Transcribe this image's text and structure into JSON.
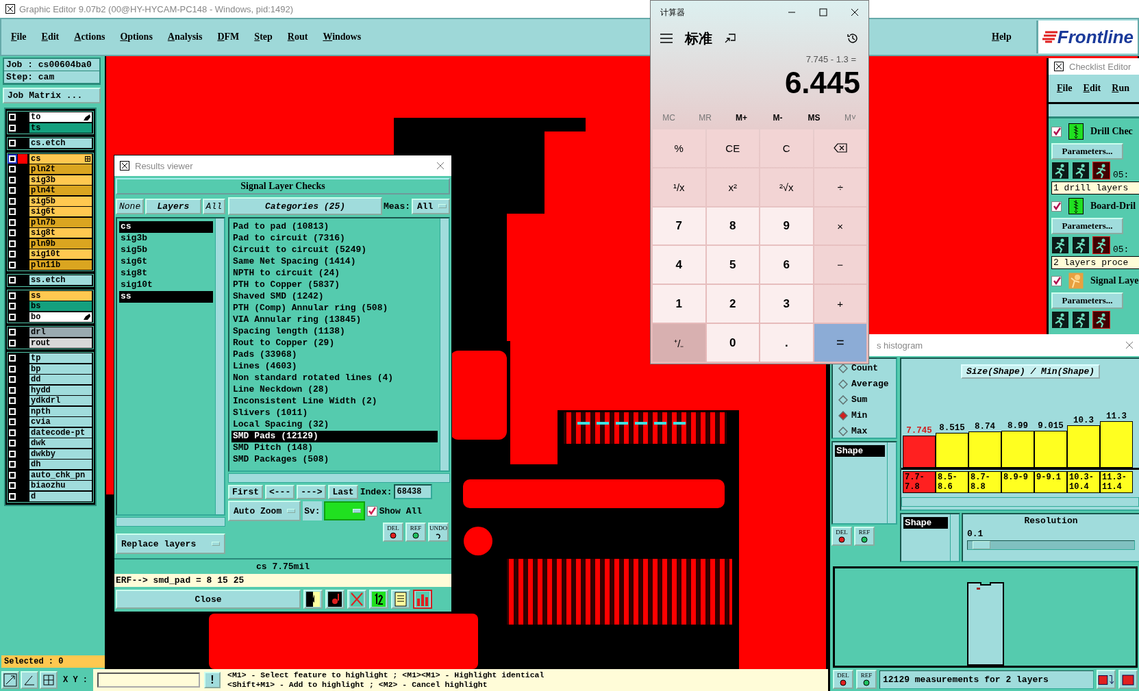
{
  "window": {
    "title": "Graphic Editor 9.07b2 (00@HY-HYCAM-PC148 - Windows, pid:1492)"
  },
  "menu": [
    "File",
    "Edit",
    "Actions",
    "Options",
    "Analysis",
    "DFM",
    "Step",
    "Rout",
    "Windows"
  ],
  "help": "Help",
  "logo": "Frontline",
  "job_panel": {
    "job": "Job : cs00604ba0",
    "step": "Step: cam",
    "matrix_button": "Job Matrix ...",
    "layer_groups": [
      {
        "layers": [
          {
            "name": "to",
            "color": "#ffffff",
            "flagged": true,
            "work_layer": false
          },
          {
            "name": "ts",
            "color": "#14a07e",
            "flagged": false,
            "work_layer": false
          }
        ]
      },
      {
        "layers": [
          {
            "name": "cs.etch",
            "color": "#a0dcdc",
            "flagged": false,
            "work_layer": false
          }
        ]
      },
      {
        "layers": [
          {
            "name": "cs",
            "color": "#ffc850",
            "flagged": false,
            "work_layer": true
          },
          {
            "name": "pln2t",
            "color": "#daa520",
            "flagged": false,
            "work_layer": false
          },
          {
            "name": "sig3b",
            "color": "#ffc850",
            "flagged": false,
            "work_layer": false
          },
          {
            "name": "pln4t",
            "color": "#daa520",
            "flagged": false,
            "work_layer": false
          },
          {
            "name": "sig5b",
            "color": "#ffc850",
            "flagged": false,
            "work_layer": false
          },
          {
            "name": "sig6t",
            "color": "#ffc850",
            "flagged": false,
            "work_layer": false
          },
          {
            "name": "pln7b",
            "color": "#daa520",
            "flagged": false,
            "work_layer": false
          },
          {
            "name": "sig8t",
            "color": "#ffc850",
            "flagged": false,
            "work_layer": false
          },
          {
            "name": "pln9b",
            "color": "#daa520",
            "flagged": false,
            "work_layer": false
          },
          {
            "name": "sig10t",
            "color": "#ffc850",
            "flagged": false,
            "work_layer": false
          },
          {
            "name": "pln11b",
            "color": "#daa520",
            "flagged": false,
            "work_layer": false
          }
        ]
      },
      {
        "layers": [
          {
            "name": "ss.etch",
            "color": "#a0dcdc",
            "flagged": false,
            "work_layer": false
          }
        ]
      },
      {
        "layers": [
          {
            "name": "ss",
            "color": "#ffc850",
            "flagged": false,
            "work_layer": false
          },
          {
            "name": "bs",
            "color": "#14a07e",
            "flagged": false,
            "work_layer": false
          },
          {
            "name": "bo",
            "color": "#ffffff",
            "flagged": true,
            "work_layer": false
          }
        ]
      },
      {
        "layers": [
          {
            "name": "drl",
            "color": "#9aaab0",
            "flagged": false,
            "work_layer": false
          },
          {
            "name": "rout",
            "color": "#d8d8d8",
            "flagged": false,
            "work_layer": false
          }
        ]
      },
      {
        "layers": [
          {
            "name": "tp",
            "color": "#a0dcdc",
            "flagged": false,
            "work_layer": false
          },
          {
            "name": "bp",
            "color": "#a0dcdc",
            "flagged": false,
            "work_layer": false
          },
          {
            "name": "dd",
            "color": "#a0dcdc",
            "flagged": false,
            "work_layer": false
          },
          {
            "name": "hydd",
            "color": "#a0dcdc",
            "flagged": false,
            "work_layer": false
          },
          {
            "name": "ydkdrl",
            "color": "#a0dcdc",
            "flagged": false,
            "work_layer": false
          },
          {
            "name": "npth",
            "color": "#a0dcdc",
            "flagged": false,
            "work_layer": false
          },
          {
            "name": "cvia",
            "color": "#a0dcdc",
            "flagged": false,
            "work_layer": false
          },
          {
            "name": "datecode-pt",
            "color": "#a0dcdc",
            "flagged": false,
            "work_layer": false
          },
          {
            "name": "dwk",
            "color": "#a0dcdc",
            "flagged": false,
            "work_layer": false
          },
          {
            "name": "dwkby",
            "color": "#a0dcdc",
            "flagged": false,
            "work_layer": false
          },
          {
            "name": "dh",
            "color": "#a0dcdc",
            "flagged": false,
            "work_layer": false
          },
          {
            "name": "auto_chk_pn",
            "color": "#a0dcdc",
            "flagged": false,
            "work_layer": false
          },
          {
            "name": "biaozhu",
            "color": "#a0dcdc",
            "flagged": false,
            "work_layer": false
          },
          {
            "name": "d",
            "color": "#a0dcdc",
            "flagged": false,
            "work_layer": false
          }
        ]
      }
    ],
    "selected_count": "Selected : 0"
  },
  "results_viewer": {
    "title": "Results viewer",
    "header": "Signal Layer Checks",
    "layer_buttons": [
      {
        "label": "None",
        "selected": false
      },
      {
        "label": "Layers",
        "selected": true
      },
      {
        "label": "All",
        "selected": false
      }
    ],
    "layers": [
      {
        "name": "cs",
        "selected": true
      },
      {
        "name": "sig3b",
        "selected": false
      },
      {
        "name": "sig5b",
        "selected": false
      },
      {
        "name": "sig6t",
        "selected": false
      },
      {
        "name": "sig8t",
        "selected": false
      },
      {
        "name": "sig10t",
        "selected": false
      },
      {
        "name": "ss",
        "selected": true
      }
    ],
    "categories_button": "Categories (25)",
    "meas_label": "Meas:",
    "meas_value": "All",
    "categories": [
      {
        "label": "Pad to pad (10813)",
        "selected": false
      },
      {
        "label": "Pad to circuit (7316)",
        "selected": false
      },
      {
        "label": "Circuit to circuit (5249)",
        "selected": false
      },
      {
        "label": "Same Net Spacing (1414)",
        "selected": false
      },
      {
        "label": "NPTH to circuit (24)",
        "selected": false
      },
      {
        "label": "PTH to Copper (5837)",
        "selected": false
      },
      {
        "label": "Shaved SMD (1242)",
        "selected": false
      },
      {
        "label": "PTH (Comp) Annular ring (508)",
        "selected": false
      },
      {
        "label": "VIA Annular ring (13845)",
        "selected": false
      },
      {
        "label": "Spacing length (1138)",
        "selected": false
      },
      {
        "label": "Rout to Copper (29)",
        "selected": false
      },
      {
        "label": "Pads (33968)",
        "selected": false
      },
      {
        "label": "Lines (4603)",
        "selected": false
      },
      {
        "label": "Non standard rotated lines (4)",
        "selected": false
      },
      {
        "label": "Line Neckdown (28)",
        "selected": false
      },
      {
        "label": "Inconsistent Line Width (2)",
        "selected": false
      },
      {
        "label": "Slivers (1011)",
        "selected": false
      },
      {
        "label": "Local Spacing (32)",
        "selected": false
      },
      {
        "label": "SMD Pads (12129)",
        "selected": true
      },
      {
        "label": "SMD Pitch (148)",
        "selected": false
      },
      {
        "label": "SMD Packages (508)",
        "selected": false
      }
    ],
    "nav": [
      "First",
      "<---",
      "--->",
      "Last"
    ],
    "index_label": "Index:",
    "index_value": "68438",
    "zoom_mode": "Auto Zoom",
    "sv_label": "Sv:",
    "show_all": {
      "label": "Show All",
      "checked": true
    },
    "replace_layers": "Replace layers",
    "small_buttons": [
      "DEL",
      "REF",
      "UNDO"
    ],
    "status": "cs 7.75mil",
    "erf_line": "ERF--> smd_pad = 8 15 25",
    "close": "Close",
    "tools": [
      {
        "kind": "pointer",
        "selected": false
      },
      {
        "kind": "marker",
        "selected": false
      },
      {
        "kind": "cross",
        "selected": false
      },
      {
        "kind": "number",
        "selected": false
      },
      {
        "kind": "report",
        "selected": false
      },
      {
        "kind": "histogram",
        "selected": true
      }
    ]
  },
  "calculator": {
    "title": "计算器",
    "mode": "标准",
    "expression": "7.745 - 1.3 =",
    "result": "6.445",
    "memory": [
      {
        "label": "MC",
        "disabled": true
      },
      {
        "label": "MR",
        "disabled": true
      },
      {
        "label": "M+",
        "disabled": false
      },
      {
        "label": "M-",
        "disabled": false
      },
      {
        "label": "MS",
        "disabled": false
      },
      {
        "label": "M˅",
        "disabled": true
      }
    ],
    "keys": [
      {
        "label": "%",
        "kind": "op",
        "hovered": false
      },
      {
        "label": "CE",
        "kind": "op",
        "hovered": false
      },
      {
        "label": "C",
        "kind": "op",
        "hovered": false
      },
      {
        "kind": "backspace",
        "hovered": false
      },
      {
        "label": "¹/x",
        "kind": "op",
        "hovered": false
      },
      {
        "label": "x²",
        "kind": "op",
        "hovered": false
      },
      {
        "label": "²√x",
        "kind": "op",
        "hovered": false
      },
      {
        "label": "÷",
        "kind": "op",
        "hovered": false
      },
      {
        "label": "7",
        "kind": "digit",
        "hovered": false
      },
      {
        "label": "8",
        "kind": "digit",
        "hovered": false
      },
      {
        "label": "9",
        "kind": "digit",
        "hovered": false
      },
      {
        "label": "×",
        "kind": "op",
        "hovered": false
      },
      {
        "label": "4",
        "kind": "digit",
        "hovered": false
      },
      {
        "label": "5",
        "kind": "digit",
        "hovered": false
      },
      {
        "label": "6",
        "kind": "digit",
        "hovered": false
      },
      {
        "label": "−",
        "kind": "op",
        "hovered": false
      },
      {
        "label": "1",
        "kind": "digit",
        "hovered": false
      },
      {
        "label": "2",
        "kind": "digit",
        "hovered": false
      },
      {
        "label": "3",
        "kind": "digit",
        "hovered": false
      },
      {
        "label": "+",
        "kind": "op",
        "hovered": false
      },
      {
        "label": "⁺/₋",
        "kind": "op",
        "hovered": true
      },
      {
        "label": "0",
        "kind": "digit",
        "hovered": false
      },
      {
        "label": ".",
        "kind": "digit",
        "hovered": false
      },
      {
        "label": "=",
        "kind": "equals",
        "hovered": false
      }
    ]
  },
  "checklist_editor": {
    "title": "Checklist Editor",
    "menu": [
      "File",
      "Edit",
      "Run"
    ],
    "checks": [
      {
        "kind": "drill",
        "checked": true,
        "name": "Drill Chec",
        "button": "Parameters...",
        "time": "05:",
        "status": "1 drill layers"
      },
      {
        "kind": "drill",
        "checked": true,
        "name": "Board-Dril",
        "button": "Parameters...",
        "time": "05:",
        "status": "2 layers proce"
      },
      {
        "kind": "signal",
        "checked": true,
        "name": "Signal Laye",
        "button": "Parameters..."
      }
    ]
  },
  "histogram_window": {
    "title": "s histogram",
    "functions": [
      {
        "label": "Count",
        "selected": false
      },
      {
        "label": "Average",
        "selected": false
      },
      {
        "label": "Sum",
        "selected": false
      },
      {
        "label": "Min",
        "selected": true
      },
      {
        "label": "Max",
        "selected": false
      }
    ],
    "shape_list": [
      {
        "label": "Shape",
        "selected": true
      }
    ],
    "chart_data": {
      "type": "bar",
      "title": "Size(Shape) / Min(Shape)",
      "categories": [
        "7.7-7.8",
        "8.5-8.6",
        "8.7-8.8",
        "8.9-9",
        "9-9.1",
        "10.3-10.4",
        "11.3-11.4"
      ],
      "values": [
        7.745,
        8.515,
        8.74,
        8.99,
        9.015,
        10.3,
        11.3
      ],
      "data_labels": true
    },
    "bins": [
      {
        "color": "#ff2020"
      },
      {
        "color": "#ffff20"
      },
      {
        "color": "#ffff20"
      },
      {
        "color": "#ffff20"
      },
      {
        "color": "#ffff20"
      },
      {
        "color": "#ffff20"
      },
      {
        "color": "#ffff20"
      }
    ],
    "lower_list": [
      {
        "label": "Shape",
        "selected": true
      }
    ],
    "resolution": {
      "label": "Resolution",
      "value": "0.1",
      "level": 0.03
    },
    "small_buttons": [
      "DEL",
      "REF"
    ],
    "bottom_buttons": [
      "DEL",
      "REF"
    ],
    "summary": "12129 measurements for 2 layers"
  },
  "bottom_bar": {
    "xy_label": "X Y :",
    "warn_button": "!",
    "hints": [
      "<M1> - Select feature to highlight ; <M1><M1> - Highlight identical",
      "<Shift+M1> - Add to highlight ; <M2> - Cancel highlight"
    ]
  }
}
